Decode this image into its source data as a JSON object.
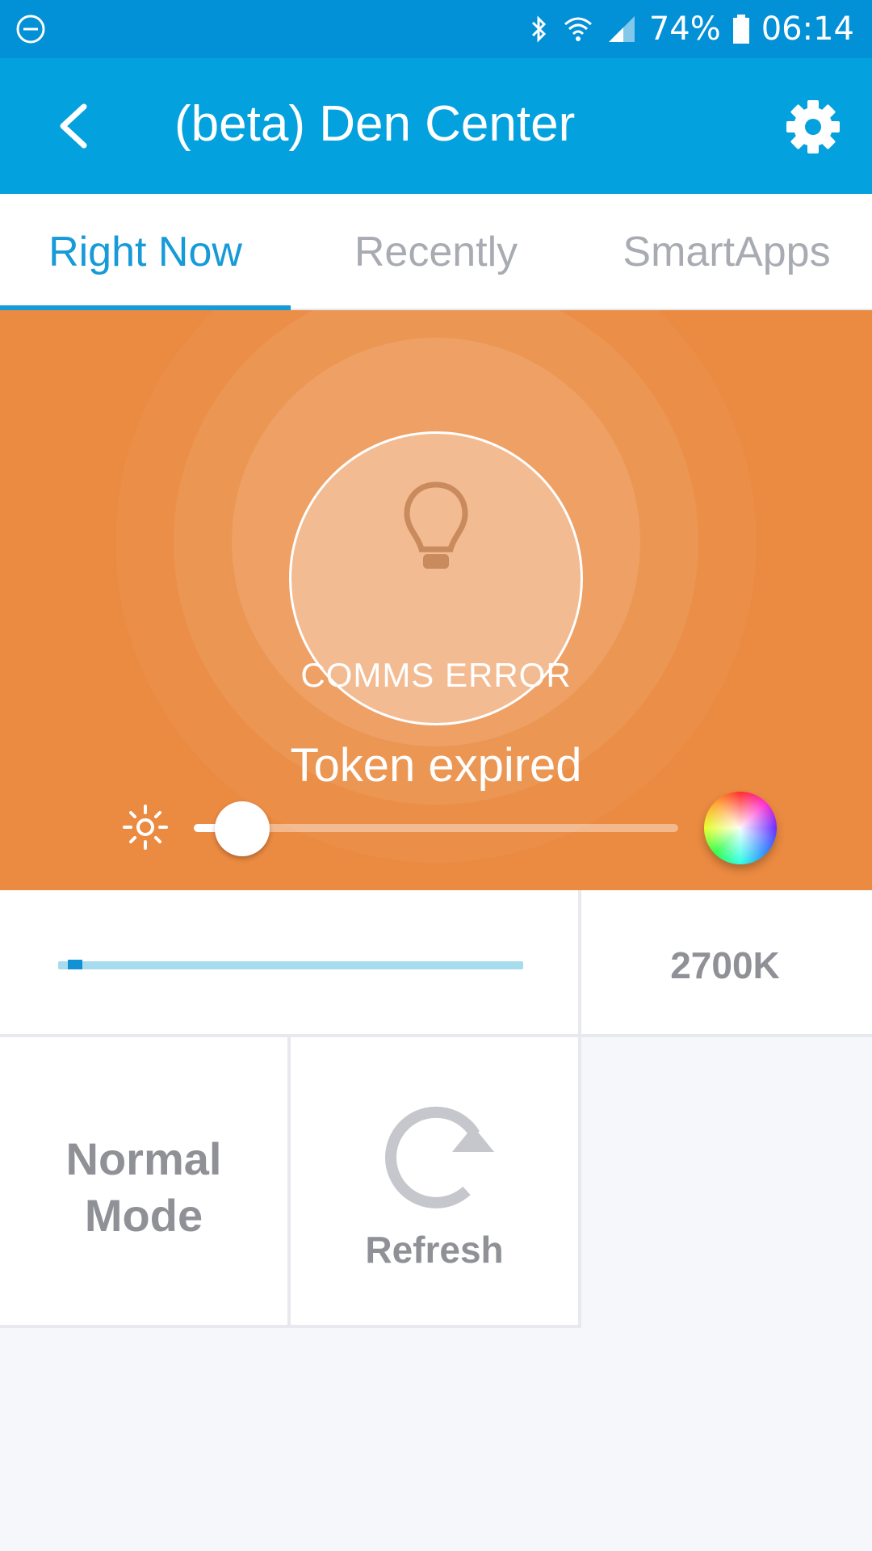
{
  "status_bar": {
    "battery": "74%",
    "time": "06:14"
  },
  "app_bar": {
    "title": "(beta) Den Center"
  },
  "tabs": [
    {
      "label": "Right Now",
      "active": true
    },
    {
      "label": "Recently",
      "active": false
    },
    {
      "label": "SmartApps",
      "active": false
    }
  ],
  "device": {
    "status": "COMMS ERROR",
    "message": "Token expired",
    "brightness_fraction": 0.1
  },
  "color_temp": {
    "value_label": "2700K",
    "slider_fraction": 0.02
  },
  "tiles": {
    "mode_line1": "Normal",
    "mode_line2": "Mode",
    "refresh_label": "Refresh"
  },
  "colors": {
    "status_bar": "#0290d6",
    "app_bar": "#03a1dd",
    "accent": "#169ad8",
    "hero": "#eb8a41"
  }
}
